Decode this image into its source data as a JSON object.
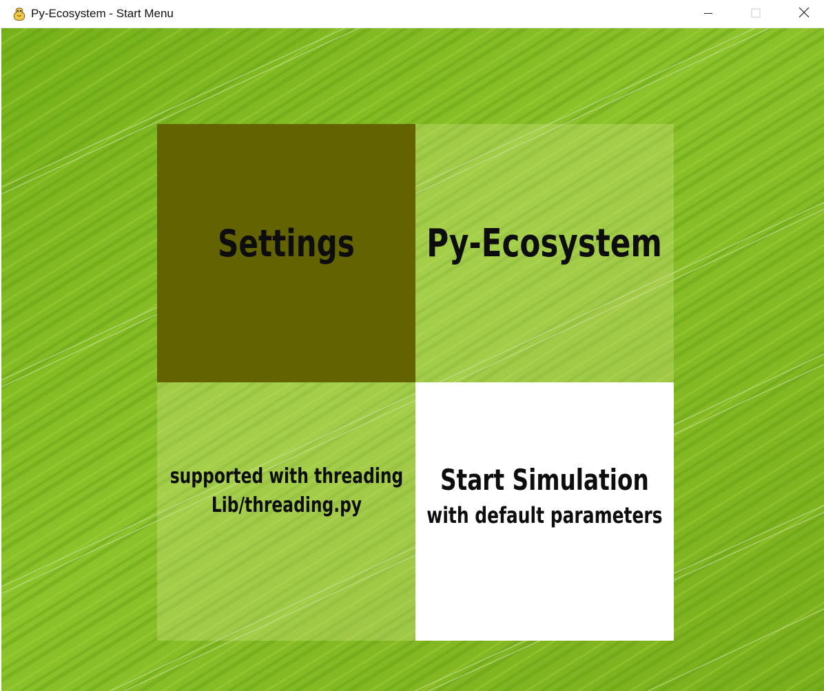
{
  "window": {
    "title": "Py-Ecosystem - Start Menu",
    "app_icon": "pygame-snake-icon",
    "controls": {
      "minimize_icon": "minimize-icon",
      "maximize_icon": "maximize-icon",
      "close_icon": "close-icon"
    }
  },
  "background": {
    "description_icon": "grass-field-background",
    "color": "#80b91f"
  },
  "menu": {
    "settings_label": "Settings",
    "app_title": "Py-Ecosystem",
    "threading_line1": "supported with threading",
    "threading_line2": "Lib/threading.py",
    "start_label": "Start Simulation",
    "start_sublabel": "with default parameters"
  },
  "colors": {
    "settings_tile": "#646302",
    "start_tile": "#ffffff",
    "translucent_tile": "rgba(215,232,140,0.33)",
    "text": "#0d0d0d"
  }
}
